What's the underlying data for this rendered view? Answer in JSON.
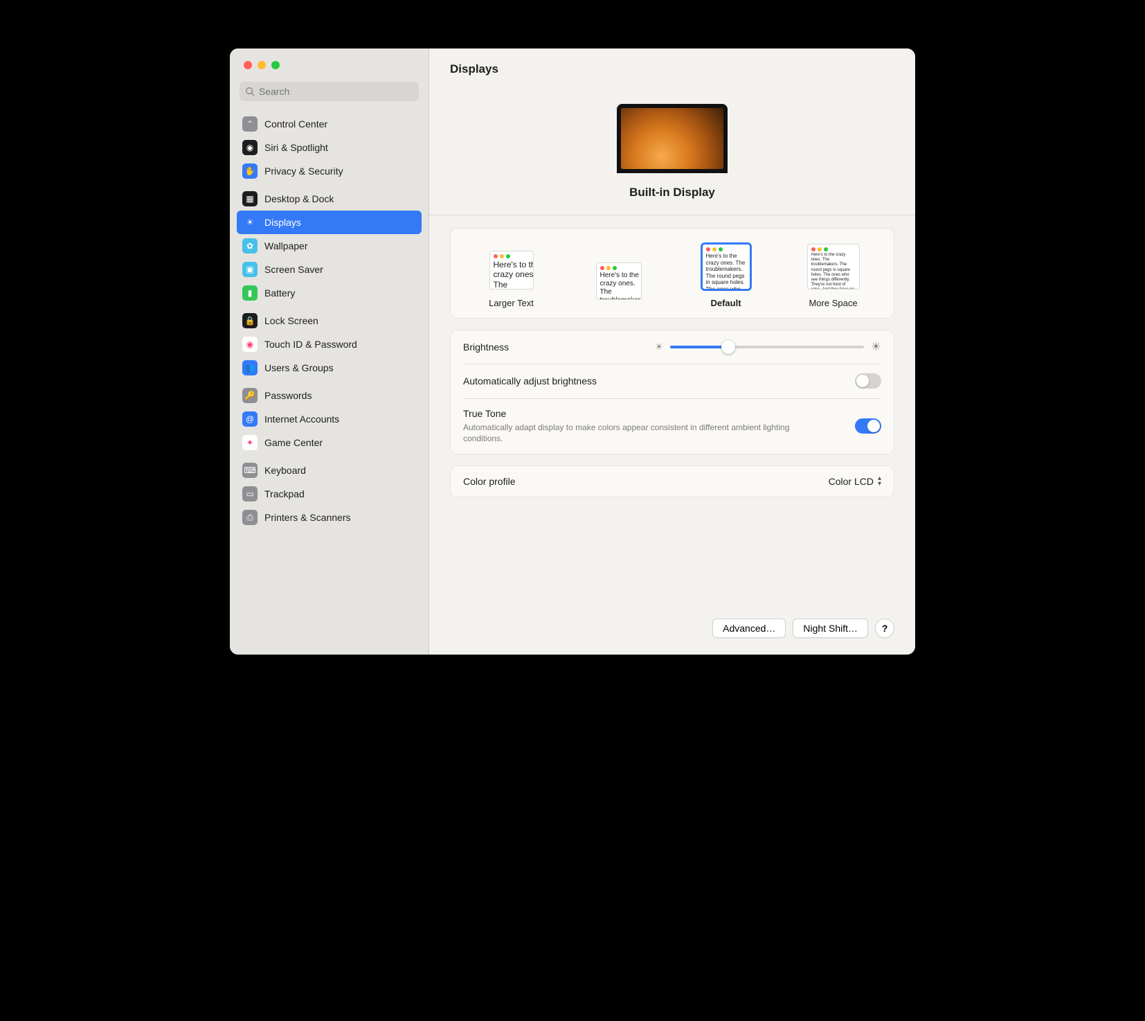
{
  "header": {
    "title": "Displays"
  },
  "search": {
    "placeholder": "Search"
  },
  "sidebar": {
    "groups": [
      {
        "items": [
          {
            "label": "Control Center",
            "icon": "control-center-icon",
            "bg": "#8e8e93"
          },
          {
            "label": "Siri & Spotlight",
            "icon": "siri-icon",
            "bg": "#1d1d1f"
          },
          {
            "label": "Privacy & Security",
            "icon": "hand-icon",
            "bg": "#3479f6"
          }
        ]
      },
      {
        "items": [
          {
            "label": "Desktop & Dock",
            "icon": "dock-icon",
            "bg": "#1d1d1f"
          },
          {
            "label": "Displays",
            "icon": "brightness-icon",
            "bg": "#3479f6",
            "selected": true
          },
          {
            "label": "Wallpaper",
            "icon": "wallpaper-icon",
            "bg": "#47c1e9"
          },
          {
            "label": "Screen Saver",
            "icon": "screensaver-icon",
            "bg": "#47c1e9"
          },
          {
            "label": "Battery",
            "icon": "battery-icon",
            "bg": "#34c759"
          }
        ]
      },
      {
        "items": [
          {
            "label": "Lock Screen",
            "icon": "lock-icon",
            "bg": "#1d1d1f"
          },
          {
            "label": "Touch ID & Password",
            "icon": "fingerprint-icon",
            "bg": "#ffffff"
          },
          {
            "label": "Users & Groups",
            "icon": "users-icon",
            "bg": "#3479f6"
          }
        ]
      },
      {
        "items": [
          {
            "label": "Passwords",
            "icon": "key-icon",
            "bg": "#8e8e93"
          },
          {
            "label": "Internet Accounts",
            "icon": "at-icon",
            "bg": "#3479f6"
          },
          {
            "label": "Game Center",
            "icon": "gamecenter-icon",
            "bg": "#ffffff"
          }
        ]
      },
      {
        "items": [
          {
            "label": "Keyboard",
            "icon": "keyboard-icon",
            "bg": "#8e8e93"
          },
          {
            "label": "Trackpad",
            "icon": "trackpad-icon",
            "bg": "#8e8e93"
          },
          {
            "label": "Printers & Scanners",
            "icon": "printer-icon",
            "bg": "#8e8e93"
          }
        ]
      }
    ]
  },
  "display": {
    "name": "Built-in Display",
    "resolutions": [
      {
        "label": "Larger Text",
        "thumb_w": 64,
        "thumb_h": 56,
        "text_size": 12,
        "selected": false
      },
      {
        "label": "",
        "thumb_w": 66,
        "thumb_h": 54,
        "text_size": 10,
        "selected": false
      },
      {
        "label": "Default",
        "thumb_w": 70,
        "thumb_h": 66,
        "text_size": 8,
        "selected": true
      },
      {
        "label": "More Space",
        "thumb_w": 76,
        "thumb_h": 66,
        "text_size": 6,
        "selected": false
      }
    ],
    "thumb_sample_text": "Here's to the crazy ones. The troublemakers. The round pegs in square holes. The ones who see things differently. They're not fond of rules. And they have no respect for the status quo. You can quote them, disagree with them, glorify or vilify them. About the only thing you can't do is ignore them. Because they change things.",
    "brightness": {
      "label": "Brightness",
      "value_pct": 30
    },
    "auto_brightness": {
      "label": "Automatically adjust brightness",
      "value": false
    },
    "true_tone": {
      "label": "True Tone",
      "sub": "Automatically adapt display to make colors appear consistent in different ambient lighting conditions.",
      "value": true
    },
    "color_profile": {
      "label": "Color profile",
      "value": "Color LCD"
    }
  },
  "footer": {
    "advanced": "Advanced…",
    "night_shift": "Night Shift…",
    "help": "?"
  }
}
